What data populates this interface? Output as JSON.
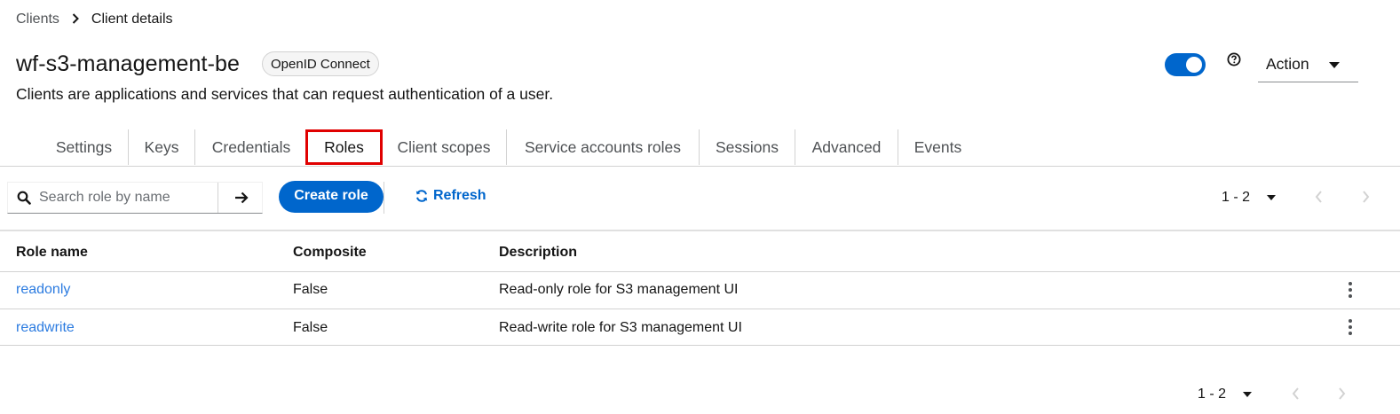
{
  "breadcrumb": {
    "parent": "Clients",
    "current": "Client details"
  },
  "header": {
    "title": "wf-s3-management-be",
    "badge": "OpenID Connect",
    "subtitle": "Clients are applications and services that can request authentication of a user.",
    "enabled": true,
    "action_label": "Action"
  },
  "tabs": [
    {
      "label": "Settings"
    },
    {
      "label": "Keys"
    },
    {
      "label": "Credentials"
    },
    {
      "label": "Roles",
      "active": true
    },
    {
      "label": "Client scopes"
    },
    {
      "label": "Service accounts roles"
    },
    {
      "label": "Sessions"
    },
    {
      "label": "Advanced"
    },
    {
      "label": "Events"
    }
  ],
  "toolbar": {
    "search_placeholder": "Search role by name",
    "create_label": "Create role",
    "refresh_label": "Refresh",
    "pagination": "1 - 2"
  },
  "table": {
    "columns": [
      "Role name",
      "Composite",
      "Description"
    ],
    "rows": [
      {
        "name": "readonly",
        "composite": "False",
        "description": "Read-only role for S3 management UI"
      },
      {
        "name": "readwrite",
        "composite": "False",
        "description": "Read-write role for S3 management UI"
      }
    ]
  },
  "footer": {
    "pagination": "1 - 2"
  },
  "colors": {
    "primary": "#0066cc",
    "link": "#2b7be0",
    "highlight": "#e00000"
  },
  "icons": [
    "chevron-right-icon",
    "help-icon",
    "caret-down-icon",
    "search-icon",
    "arrow-right-icon",
    "refresh-icon",
    "kebab-icon",
    "angle-left-icon",
    "angle-right-icon"
  ]
}
